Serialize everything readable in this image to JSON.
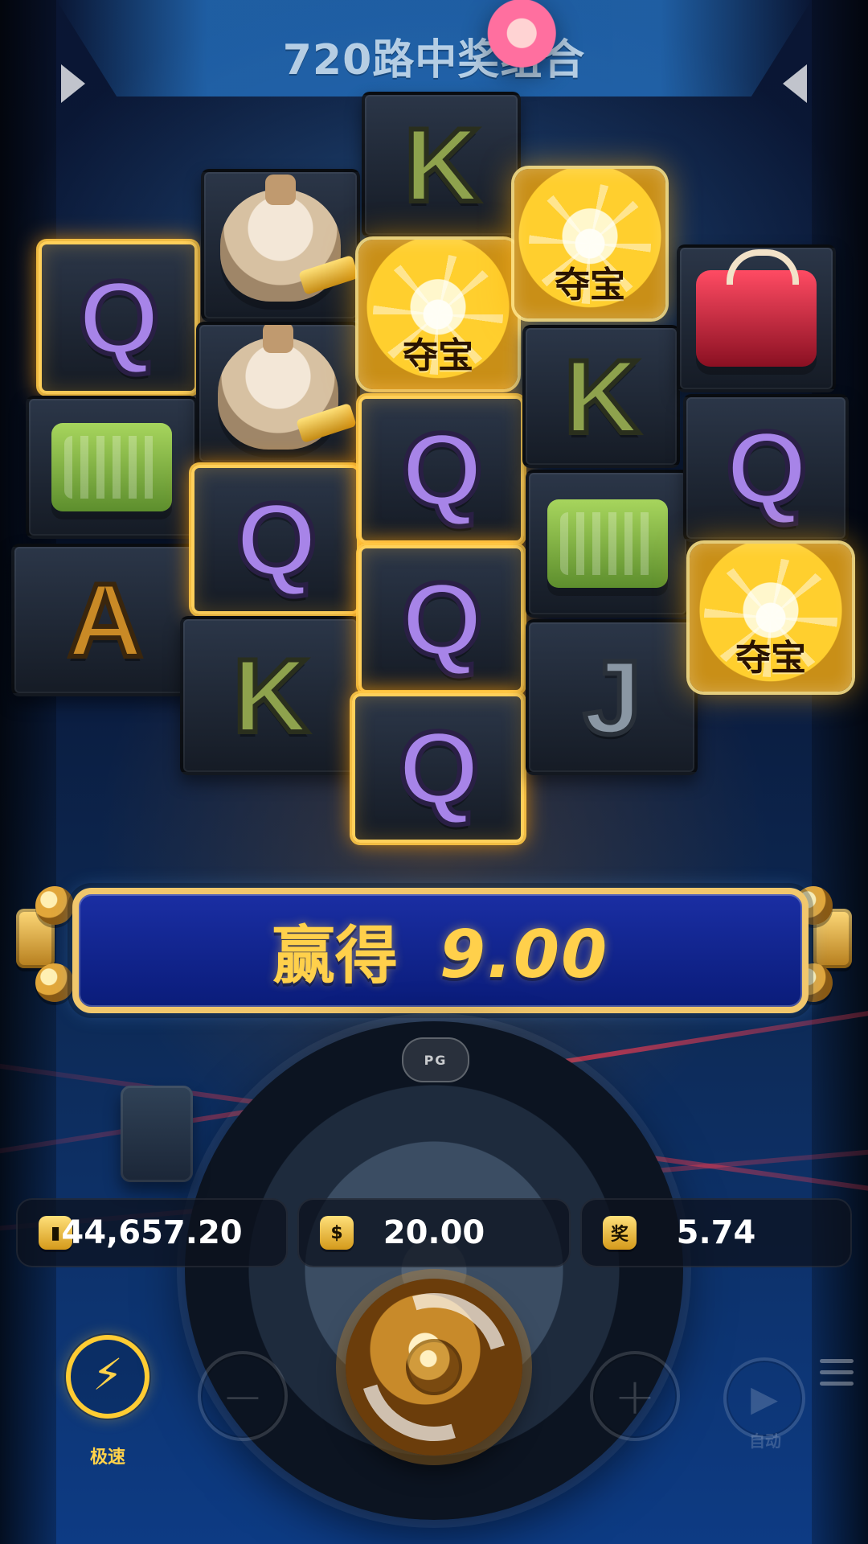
{
  "header": {
    "banner_text": "720路中奖组合"
  },
  "reels": {
    "columns": [
      {
        "symbols": [
          "Q",
          "cash-stack",
          "A"
        ]
      },
      {
        "symbols": [
          "money-bag",
          "money-bag",
          "Q",
          "K"
        ]
      },
      {
        "symbols": [
          "K",
          "vault",
          "Q",
          "Q",
          "Q"
        ]
      },
      {
        "symbols": [
          "vault",
          "K",
          "cash-stack",
          "J"
        ]
      },
      {
        "symbols": [
          "red-purse",
          "Q",
          "vault"
        ]
      }
    ],
    "vault_label": "夺宝"
  },
  "win": {
    "label": "赢得",
    "value": "9.00"
  },
  "stats": {
    "balance": "44,657.20",
    "bet": "20.00",
    "last_win": "5.74",
    "bet_icon_text": "$",
    "win_icon_text": "奖"
  },
  "controls": {
    "turbo_label": "极速",
    "minus": "−",
    "plus": "+",
    "auto_label": "自动"
  },
  "brand": {
    "badge": "PG"
  }
}
